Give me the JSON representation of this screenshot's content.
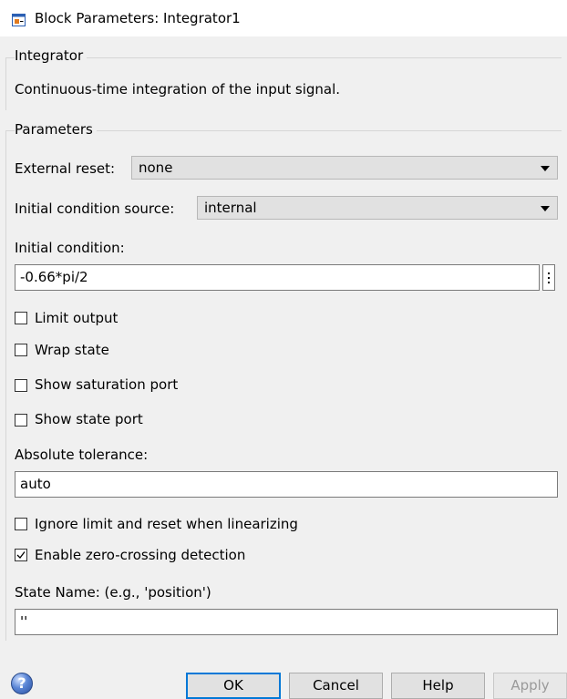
{
  "window": {
    "title": "Block Parameters: Integrator1",
    "icon": "simulink-block-icon"
  },
  "block_group": {
    "label": "Integrator",
    "description": "Continuous-time integration of the input signal."
  },
  "parameters_group": {
    "label": "Parameters",
    "external_reset": {
      "label": "External reset:",
      "value": "none"
    },
    "initial_condition_source": {
      "label": "Initial condition source:",
      "value": "internal"
    },
    "initial_condition": {
      "label": "Initial condition:",
      "value": "-0.66*pi/2"
    },
    "checkboxes": [
      {
        "label": "Limit output",
        "checked": false
      },
      {
        "label": "Wrap state",
        "checked": false
      },
      {
        "label": "Show saturation port",
        "checked": false
      },
      {
        "label": "Show state port",
        "checked": false
      }
    ],
    "absolute_tolerance": {
      "label": "Absolute tolerance:",
      "value": "auto"
    },
    "checkboxes2": [
      {
        "label": "Ignore limit and reset when linearizing",
        "checked": false
      },
      {
        "label": "Enable zero-crossing detection",
        "checked": true
      }
    ],
    "state_name": {
      "label": "State Name: (e.g., 'position')",
      "value": "''"
    }
  },
  "buttons": {
    "help_icon": "?",
    "ok": "OK",
    "cancel": "Cancel",
    "help": "Help",
    "apply": "Apply"
  }
}
